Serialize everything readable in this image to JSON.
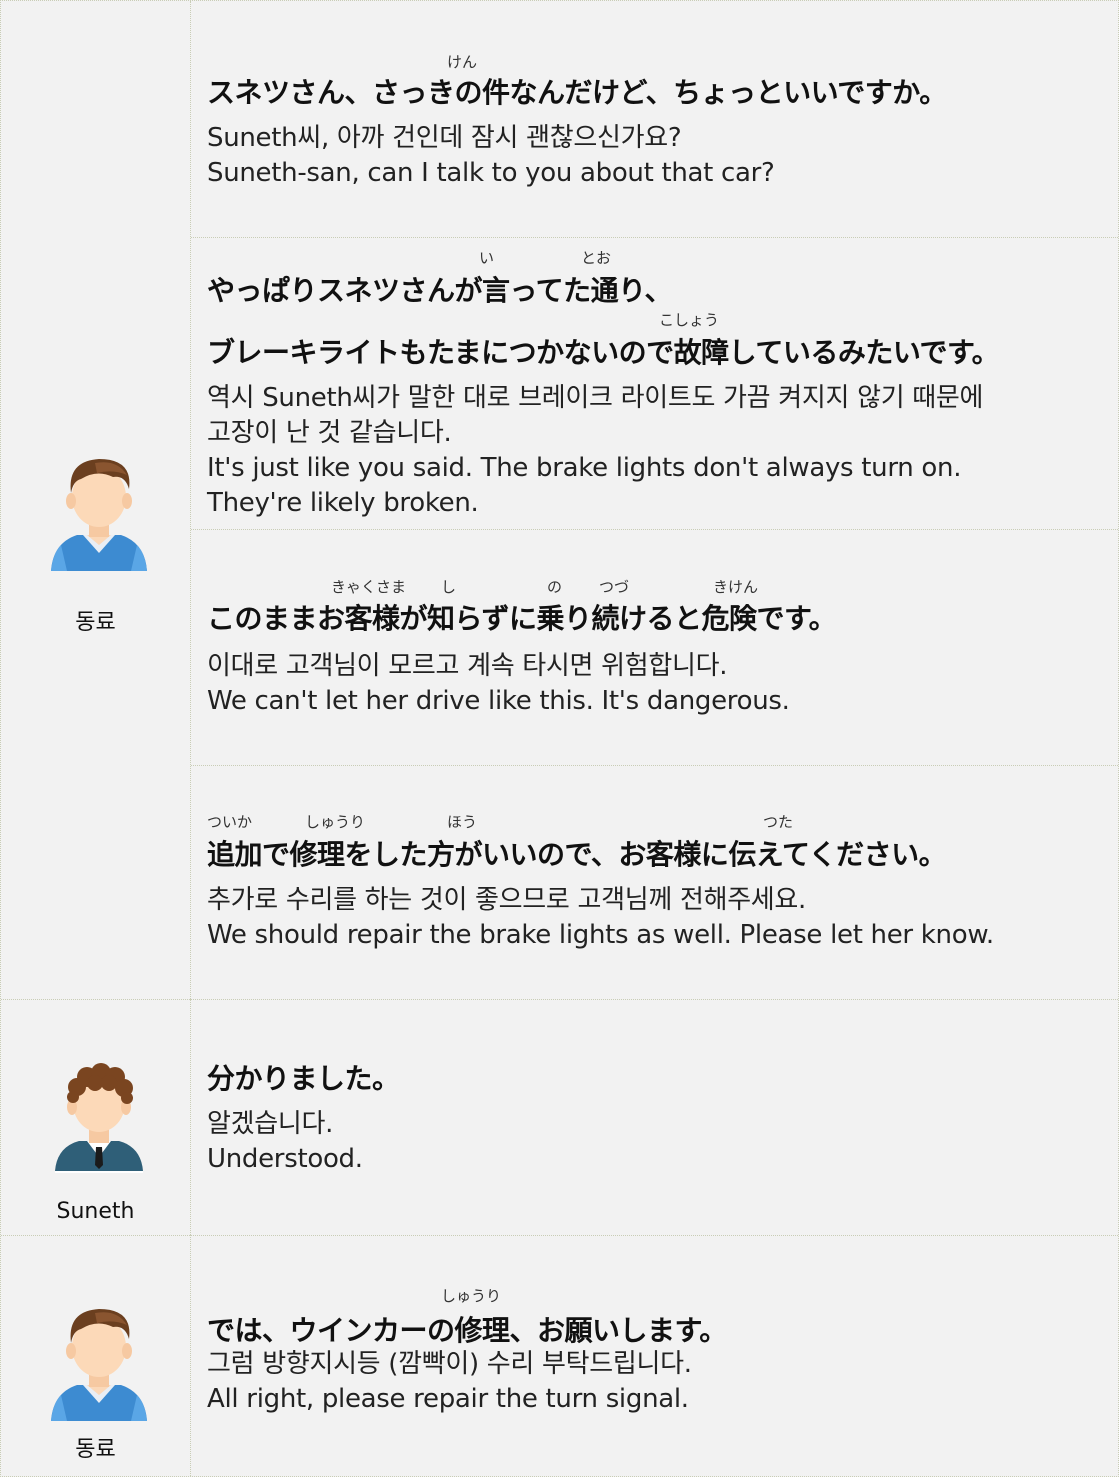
{
  "speakers": {
    "colleague": "동료",
    "suneth": "Suneth"
  },
  "lines": [
    {
      "furigana": [
        "けん"
      ],
      "japanese": [
        "スネツさん、さっきの件なんだけど、ちょっといいですか。"
      ],
      "translation": [
        "Suneth씨, 아까 건인데 잠시 괜찮으신가요?",
        "Suneth-san, can I talk to you about that car?"
      ]
    },
    {
      "furigana": [
        "い",
        "とお",
        "こしょう"
      ],
      "japanese": [
        "やっぱりスネツさんが言ってた通り、",
        "ブレーキライトもたまにつかないので故障しているみたいです。"
      ],
      "translation": [
        "역시 Suneth씨가 말한 대로 브레이크 라이트도 가끔 켜지지 않기 때문에",
        "고장이 난 것 같습니다.",
        "It's just like you said. The brake lights don't always turn on.",
        "They're likely broken."
      ]
    },
    {
      "furigana": [
        "きゃくさま",
        "し",
        "の",
        "つづ",
        "きけん"
      ],
      "japanese": [
        "このままお客様が知らずに乗り続けると危険です。"
      ],
      "translation": [
        "이대로 고객님이 모르고 계속 타시면 위험합니다.",
        "We can't let her drive like this. It's dangerous."
      ]
    },
    {
      "furigana": [
        "ついか",
        "しゅうり",
        "ほう",
        "つた"
      ],
      "japanese": [
        "追加で修理をした方がいいので、お客様に伝えてください。"
      ],
      "translation": [
        "추가로 수리를 하는 것이 좋으므로 고객님께 전해주세요.",
        "We should repair the brake lights as well. Please let her know."
      ]
    },
    {
      "furigana": [],
      "japanese": [
        "分かりました。"
      ],
      "translation": [
        "알겠습니다.",
        "Understood."
      ]
    },
    {
      "furigana": [
        "しゅうり"
      ],
      "japanese": [
        "では、ウインカーの修理、お願いします。"
      ],
      "translation": [
        "그럼 방향지시등 (깜빡이) 수리 부탁드립니다.",
        "All right, please repair the turn signal."
      ]
    }
  ]
}
